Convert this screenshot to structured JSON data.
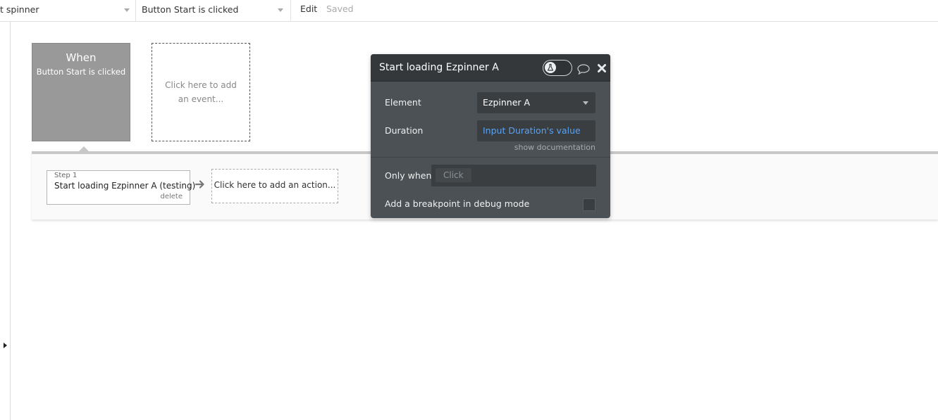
{
  "topbar": {
    "page_select": "t spinner",
    "event_select": "Button Start is clicked",
    "edit_label": "Edit",
    "saved_label": "Saved"
  },
  "event": {
    "when_label": "When",
    "trigger": "Button Start is clicked",
    "add_event": "Click here to add an event..."
  },
  "workflow": {
    "steps": [
      {
        "number": "Step 1",
        "title": "Start loading Ezpinner A (testing)",
        "delete_label": "delete"
      }
    ],
    "add_action": "Click here to add an action..."
  },
  "panel": {
    "title": "Start loading Ezpinner A",
    "element_label": "Element",
    "element_value": "Ezpinner A",
    "duration_label": "Duration",
    "duration_value": "Input Duration's value",
    "show_documentation": "show documentation",
    "only_when_label": "Only when",
    "only_when_chip": "Click",
    "breakpoint_label": "Add a breakpoint in debug mode",
    "icons": [
      "toggle-icon",
      "comment-icon",
      "close-icon"
    ]
  },
  "colors": {
    "event_card": "#999999",
    "panel_bg": "#4c5155",
    "panel_header": "#34383b",
    "dynamic_text": "#5aa2f0"
  }
}
